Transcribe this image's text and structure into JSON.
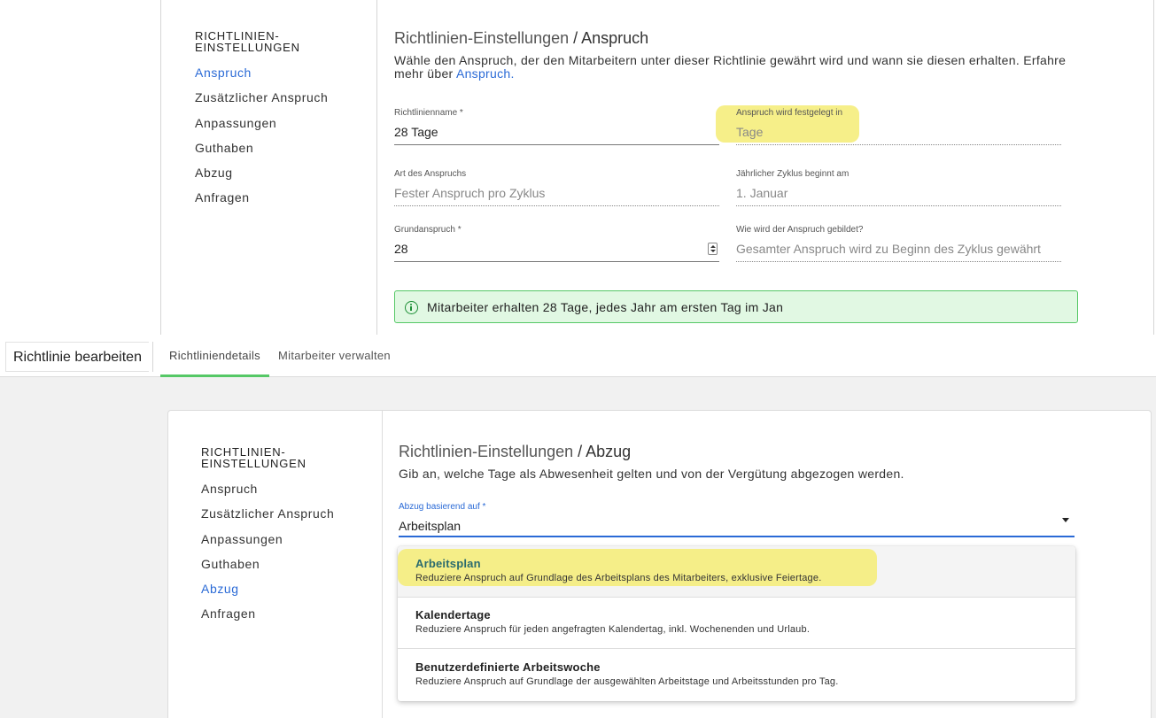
{
  "top": {
    "nav": {
      "heading": "RICHTLINIEN-\nEINSTELLUNGEN",
      "items": [
        {
          "label": "Anspruch",
          "active": true
        },
        {
          "label": "Zusätzlicher Anspruch",
          "active": false
        },
        {
          "label": "Anpassungen",
          "active": false
        },
        {
          "label": "Guthaben",
          "active": false
        },
        {
          "label": "Abzug",
          "active": false
        },
        {
          "label": "Anfragen",
          "active": false
        }
      ]
    },
    "title_prefix": "Richtlinien-Einstellungen",
    "title_sep": " / ",
    "title_section": "Anspruch",
    "description": "Wähle den Anspruch, der den Mitarbeitern unter dieser Richtlinie gewährt wird und wann sie diesen erhalten. Erfahre mehr über ",
    "description_link": "Anspruch.",
    "fields": {
      "policy_name": {
        "label": "Richtlinienname *",
        "value": "28 Tage"
      },
      "unit": {
        "label": "Anspruch wird festgelegt in",
        "value": "Tage"
      },
      "type": {
        "label": "Art des Anspruchs",
        "value": "Fester Anspruch pro Zyklus"
      },
      "cycle_start": {
        "label": "Jährlicher Zyklus beginnt am",
        "value": "1. Januar"
      },
      "base": {
        "label": "Grundanspruch *",
        "value": "28"
      },
      "accrual": {
        "label": "Wie wird der Anspruch gebildet?",
        "value": "Gesamter Anspruch wird zu Beginn des Zyklus gewährt"
      }
    },
    "alert": "Mitarbeiter erhalten 28 Tage, jedes Jahr am ersten Tag im Jan"
  },
  "tabbar": {
    "page_title": "Richtlinie bearbeiten",
    "tabs": [
      {
        "label": "Richtliniendetails",
        "active": true
      },
      {
        "label": "Mitarbeiter verwalten",
        "active": false
      }
    ]
  },
  "bottom": {
    "nav": {
      "heading": "RICHTLINIEN-\nEINSTELLUNGEN",
      "items": [
        {
          "label": "Anspruch",
          "active": false
        },
        {
          "label": "Zusätzlicher Anspruch",
          "active": false
        },
        {
          "label": "Anpassungen",
          "active": false
        },
        {
          "label": "Guthaben",
          "active": false
        },
        {
          "label": "Abzug",
          "active": true
        },
        {
          "label": "Anfragen",
          "active": false
        }
      ]
    },
    "title_prefix": "Richtlinien-Einstellungen",
    "title_sep": " / ",
    "title_section": "Abzug",
    "description": "Gib an, welche Tage als Abwesenheit gelten und von der Vergütung abgezogen werden.",
    "select": {
      "label": "Abzug basierend auf *",
      "value": "Arbeitsplan"
    },
    "options": [
      {
        "title": "Arbeitsplan",
        "desc": "Reduziere Anspruch auf Grundlage des Arbeitsplans des Mitarbeiters, exklusive Feiertage.",
        "selected": true
      },
      {
        "title": "Kalendertage",
        "desc": "Reduziere Anspruch für jeden angefragten Kalendertag, inkl. Wochenenden und Urlaub.",
        "selected": false
      },
      {
        "title": "Benutzerdefinierte Arbeitswoche",
        "desc": "Reduziere Anspruch auf Grundlage der ausgewählten Arbeitstage und Arbeitsstunden pro Tag.",
        "selected": false
      }
    ]
  },
  "colors": {
    "accent": "#2a6ad6",
    "success_border": "#55c866",
    "success_bg": "#e1f8e3",
    "highlight": "#f4ec74"
  }
}
